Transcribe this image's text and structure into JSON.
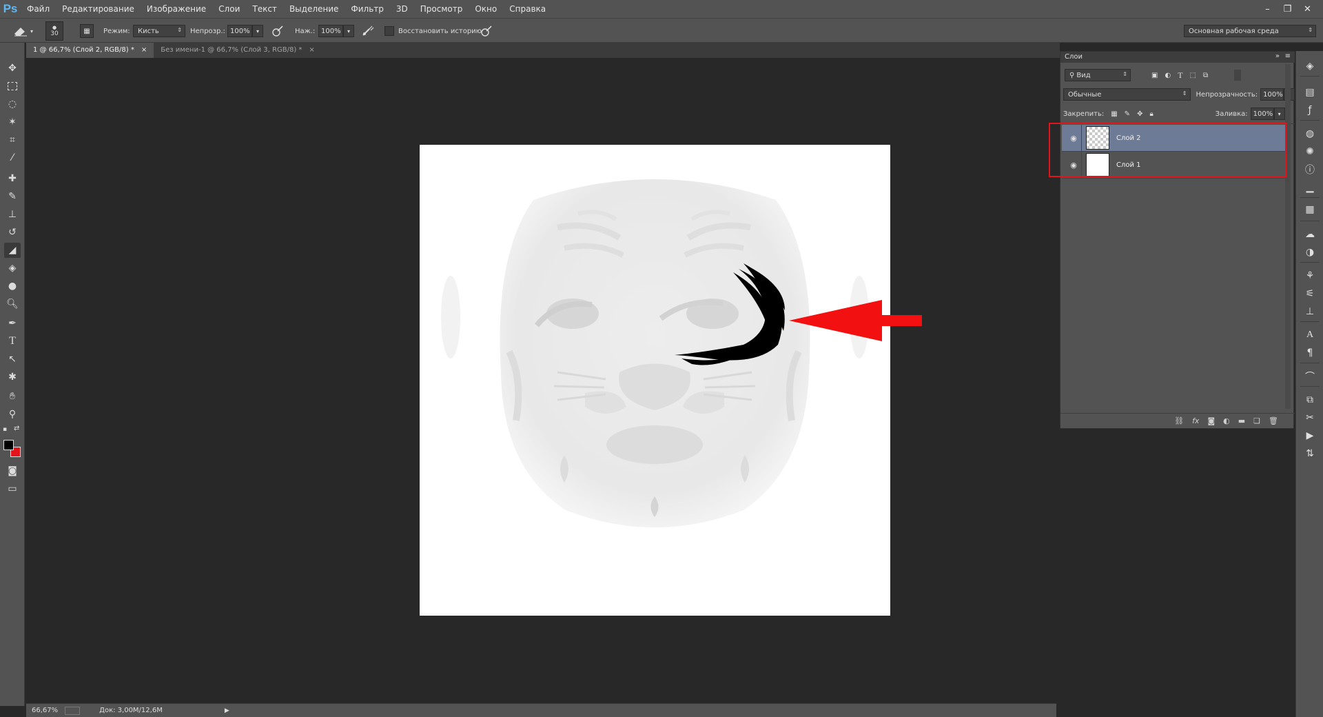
{
  "app": {
    "logo": "Ps",
    "menu": [
      "Файл",
      "Редактирование",
      "Изображение",
      "Слои",
      "Текст",
      "Выделение",
      "Фильтр",
      "3D",
      "Просмотр",
      "Окно",
      "Справка"
    ],
    "window_buttons": [
      "–",
      "❐",
      "✕"
    ]
  },
  "options_bar": {
    "brush_size": "30",
    "mode_label": "Режим:",
    "mode_value": "Кисть",
    "opacity_label": "Непрозр.:",
    "opacity_value": "100%",
    "pressure_label": "Наж.:",
    "pressure_value": "100%",
    "restore_history_label": "Восстановить историю",
    "workspace": "Основная рабочая среда"
  },
  "tabs": [
    {
      "label": "1 @ 66,7% (Слой 2, RGB/8) *",
      "active": true
    },
    {
      "label": "Без имени-1 @ 66,7% (Слой 3, RGB/8) *",
      "active": false
    }
  ],
  "status": {
    "zoom": "66,67%",
    "doc": "Док: 3,00M/12,6M"
  },
  "layers_panel": {
    "title": "Слои",
    "filter_kind": "Вид",
    "blend_mode": "Обычные",
    "opacity_label": "Непрозрачность:",
    "opacity_value": "100%",
    "lock_label": "Закрепить:",
    "fill_label": "Заливка:",
    "fill_value": "100%",
    "layers": [
      {
        "name": "Слой 2",
        "selected": true
      },
      {
        "name": "Слой 1",
        "selected": false
      }
    ]
  },
  "colors": {
    "foreground": "#000000",
    "background": "#e3141b",
    "accent_red": "#e3141b",
    "selected_layer": "#6d7b96"
  }
}
